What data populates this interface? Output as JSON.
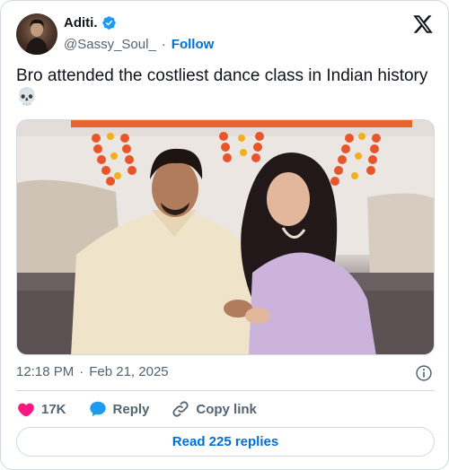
{
  "author": {
    "display_name": "Aditi.",
    "handle": "@Sassy_Soul_",
    "separator": "·",
    "follow_label": "Follow"
  },
  "tweet": {
    "text": "Bro attended the costliest dance class in Indian history 💀",
    "time": "12:18 PM",
    "date_separator": "·",
    "date": "Feb 21, 2025"
  },
  "actions": {
    "likes_count": "17K",
    "reply_label": "Reply",
    "copy_link_label": "Copy link"
  },
  "read_replies_label": "Read 225 replies",
  "colors": {
    "like": "#f91880",
    "reply": "#1d9bf0",
    "link": "#006fd6",
    "verified": "#1d9bf0"
  },
  "icons": [
    "verified-badge-icon",
    "x-logo-icon",
    "info-icon",
    "heart-icon",
    "reply-bubble-icon",
    "link-icon"
  ]
}
